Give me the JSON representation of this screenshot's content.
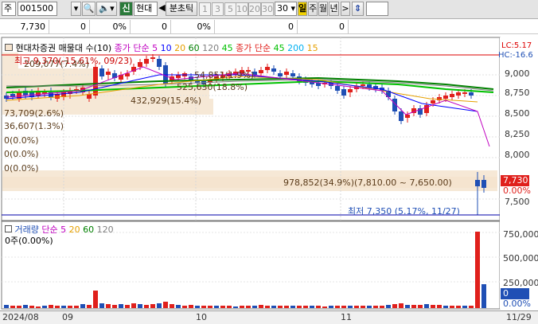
{
  "toolbar": {
    "menu_label": "주",
    "code": "001500",
    "signal_label": "신",
    "stock_name": "현대",
    "period_label": "분초틱",
    "intervals": [
      "1",
      "3",
      "5",
      "10",
      "20",
      "30"
    ],
    "interval_value": "30",
    "day_label": "일",
    "week_label": "주",
    "month_label": "월",
    "year_label": "년"
  },
  "infobar": {
    "price": "7,730",
    "v1": "0",
    "v2": "0%",
    "v3": "0",
    "v4": "0%",
    "v5": "0",
    "v6": "0"
  },
  "price_chart": {
    "legend_name": "현대차증권 매물대 수(10)",
    "legend_ma_label": "종가 단순",
    "legend_ma_periods": [
      "5",
      "10",
      "20",
      "60",
      "120",
      "45"
    ],
    "legend_ma2_label": "종가 단순",
    "legend_ma2_periods": [
      "45",
      "200",
      "15"
    ],
    "high_label": "최고 9,370(-15.61%, 09/23)",
    "low_label": "최저 7,350 (5.17%, 11/27)",
    "lc_label": "LC:5.17",
    "hc_label": "HC:-16.6",
    "volume_profile": [
      "209,077(7.4%)",
      "54,851(1.9%)",
      "525,630(18.8%)",
      "432,929(15.4%)",
      "73,709(2.6%)",
      "36,607(1.3%)",
      "0(0.0%)",
      "0(0.0%)",
      "0(0.0%)",
      "978,852(34.9%)(7,810.00 ~ 7,650.00)"
    ],
    "y_ticks": [
      "9,000",
      "8,750",
      "8,500",
      "8,250",
      "8,000",
      "7,500"
    ],
    "current_price": "7,730",
    "current_pct": "0.00%"
  },
  "volume_chart": {
    "legend_name": "거래량",
    "legend_ma_label": "단순",
    "legend_ma_periods": [
      "5",
      "20",
      "60",
      "120"
    ],
    "value_label": "0주(0.00%)",
    "y_ticks": [
      "750,000",
      "500,000",
      "250,000"
    ],
    "current_value": "0",
    "current_pct": "0.00%"
  },
  "dates": [
    "2024/08",
    "09",
    "10",
    "11",
    "11/29"
  ],
  "colors": {
    "up": "#e0201c",
    "down": "#1f4fb5",
    "ma5": "#c000c0",
    "ma10": "#0000ff",
    "ma20": "#e6a000",
    "ma60": "#008000",
    "ma120": "#808080",
    "ma45": "#00c000",
    "profile": "#f5e4cf"
  }
}
